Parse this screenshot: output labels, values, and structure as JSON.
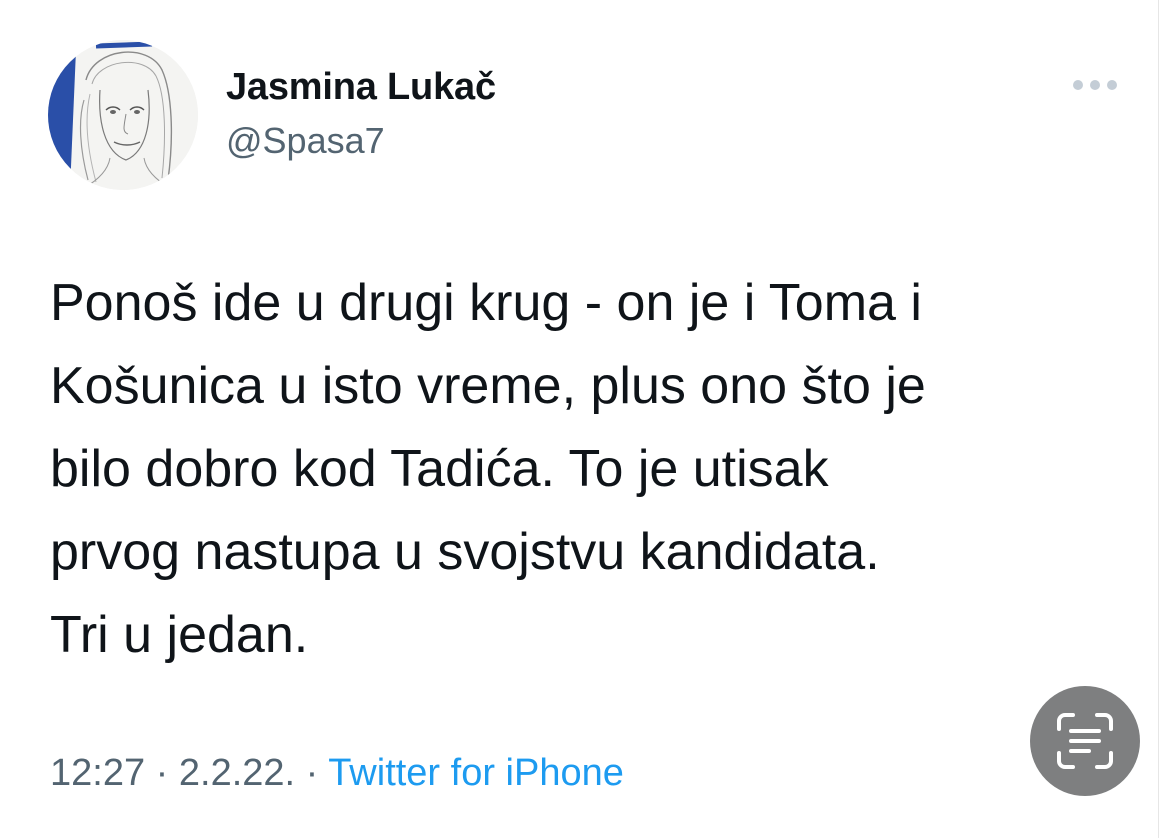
{
  "tweet": {
    "author": {
      "display_name": "Jasmina Lukač",
      "handle": "@Spasa7",
      "avatar_icon": "portrait-sketch"
    },
    "text_lines": [
      "Ponoš ide u drugi krug - on je i Toma i",
      "Košunica u isto vreme, plus ono što je",
      "bilo dobro kod Tadića. To je utisak",
      "prvog nastupa u svojstvu kandidata.",
      "Tri u jedan."
    ],
    "time": "12:27",
    "date": "2.2.22.",
    "separator": "·",
    "source": "Twitter for iPhone"
  },
  "icons": {
    "more": "more-horizontal-icon",
    "scan": "live-text-scan-icon"
  },
  "colors": {
    "text_primary": "#0f1419",
    "text_secondary": "#536471",
    "link": "#1d9bf0",
    "avatar_accent": "#2a4fa8",
    "scan_button_bg": "#7e7f80"
  }
}
